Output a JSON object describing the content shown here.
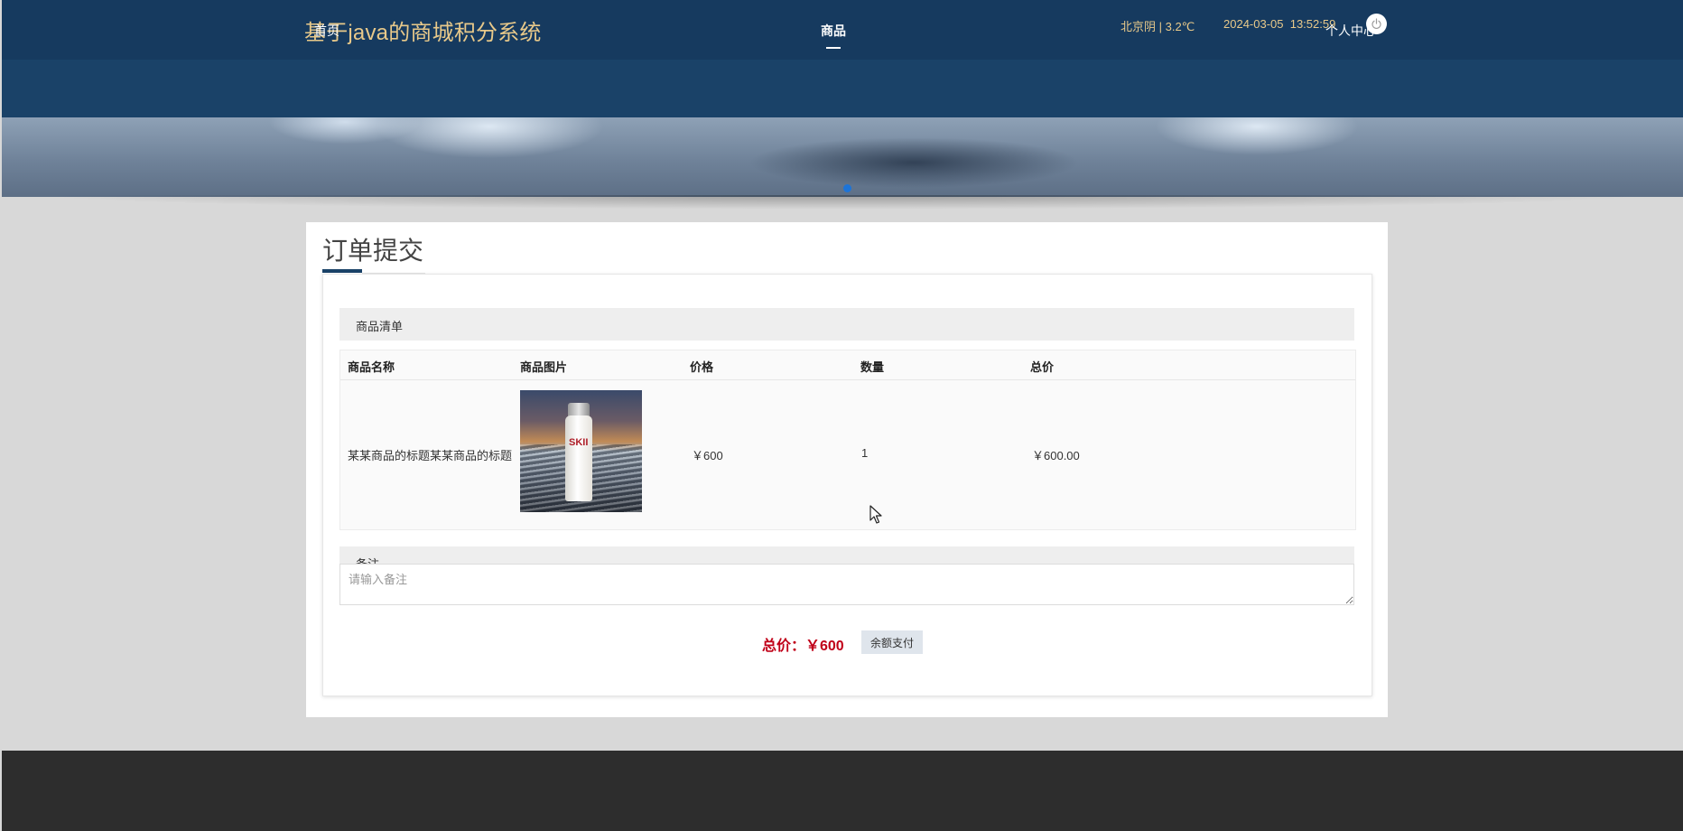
{
  "header": {
    "site_title": "基于java的商城积分系统",
    "weather": "北京阴 | 3.2℃",
    "datetime": "2024-03-05  13:52:59"
  },
  "nav": {
    "home": "首页",
    "goods": "商品",
    "user_center": "个人中心",
    "active": "商品"
  },
  "page": {
    "title": "订单提交"
  },
  "order": {
    "list_heading": "商品清单",
    "columns": [
      "商品名称",
      "商品图片",
      "价格",
      "数量",
      "总价"
    ],
    "rows": [
      {
        "name": "某某商品的标题某某商品的标题",
        "price": "￥600",
        "quantity": "1",
        "total": "￥600.00",
        "image_label": "SKII"
      }
    ],
    "note_heading": "备注",
    "note_placeholder": "请输入备注",
    "total_label": "总价：￥600",
    "pay_button": "余额支付"
  },
  "colors": {
    "header_bg": "#163a5f",
    "nav_bg": "#1a4268",
    "title_gold": "#e8c98a",
    "total_red": "#c00018",
    "footer_bg": "#2d2d2d"
  },
  "icons": [
    "power-icon",
    "mouse-cursor-icon"
  ]
}
